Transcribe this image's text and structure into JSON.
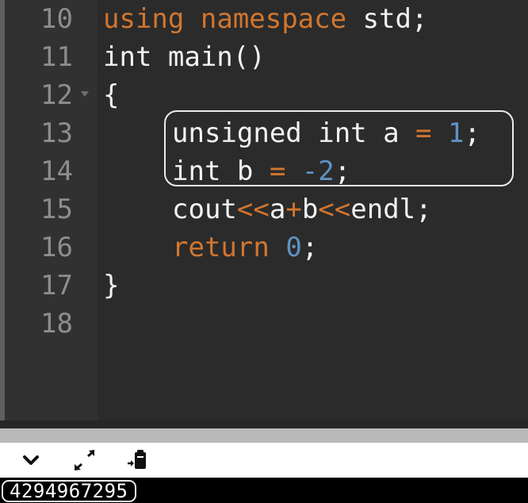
{
  "editor": {
    "lines": [
      {
        "number": "10",
        "tokens": [
          "using",
          " ",
          "namespace",
          " std;"
        ]
      },
      {
        "number": "11",
        "tokens": [
          "int main()"
        ]
      },
      {
        "number": "12",
        "tokens": [
          "{"
        ]
      },
      {
        "number": "13",
        "tokens": [
          "unsigned int a ",
          "=",
          " ",
          "1",
          ";"
        ]
      },
      {
        "number": "14",
        "tokens": [
          "int b ",
          "=",
          " ",
          "-2",
          ";"
        ]
      },
      {
        "number": "15",
        "tokens": [
          "cout",
          "<<",
          "a",
          "+",
          "b",
          "<<",
          "endl;"
        ]
      },
      {
        "number": "16",
        "tokens": [
          "return",
          " ",
          "0",
          ";"
        ]
      },
      {
        "number": "17",
        "tokens": [
          "}"
        ]
      },
      {
        "number": "18",
        "tokens": [
          ""
        ]
      }
    ]
  },
  "console": {
    "output": "4294967295",
    "controls": [
      "collapse-icon",
      "expand-icon",
      "clipboard-icon"
    ]
  },
  "colors": {
    "background": "#2b2b2b",
    "keyword": "#d2762f",
    "number": "#5e93c3",
    "text": "#f2f2f2",
    "line_number": "#8d8d8d"
  }
}
